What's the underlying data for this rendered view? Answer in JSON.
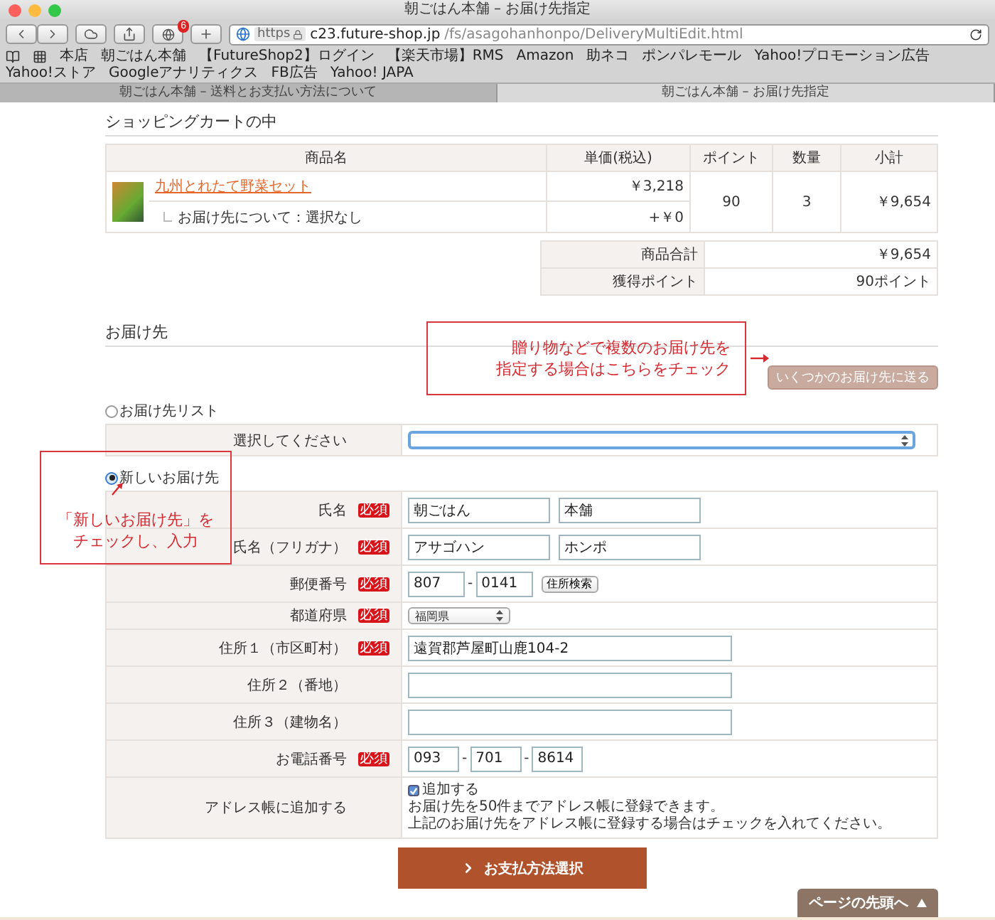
{
  "window": {
    "title": "朝ごはん本舗 – お届け先指定"
  },
  "toolbar": {
    "notification_count": "6",
    "url": {
      "scheme": "https",
      "host": "c23.future-shop.jp",
      "path": "/fs/asagohanhonpo/DeliveryMultiEdit.html"
    }
  },
  "bookmarks": [
    "本店",
    "朝ごはん本舗",
    "【FutureShop2】ログイン",
    "【楽天市場】RMS",
    "Amazon",
    "助ネコ",
    "ポンパレモール",
    "Yahoo!プロモーション広告",
    "Yahoo!ストア",
    "Googleアナリティクス",
    "FB広告",
    "Yahoo! JAPA"
  ],
  "tabs": [
    {
      "label": "朝ごはん本舗 – 送料とお支払い方法について",
      "selected": false
    },
    {
      "label": "朝ごはん本舗 – お届け先指定",
      "selected": true
    }
  ],
  "cart": {
    "heading": "ショッピングカートの中",
    "columns": [
      "商品名",
      "単価(税込)",
      "ポイント",
      "数量",
      "小計"
    ],
    "items": [
      {
        "name": "九州とれたて野菜セット",
        "option": "お届け先について：選択なし",
        "price": "￥3,218",
        "option_price": "+￥0",
        "points": "90",
        "quantity": "3",
        "subtotal": "￥9,654"
      }
    ],
    "summary": [
      {
        "label": "商品合計",
        "value": "￥9,654"
      },
      {
        "label": "獲得ポイント",
        "value": "90ポイント"
      }
    ]
  },
  "delivery": {
    "heading": "お届け先",
    "multi_button": "いくつかのお届け先に送る",
    "address_list": {
      "label": "お届け先リスト",
      "selected": false,
      "select_label": "選択してください"
    },
    "new_address": {
      "label": "新しいお届け先",
      "selected": true,
      "fields": [
        {
          "kind": "pair",
          "label": "氏名",
          "badge": "必須",
          "values": [
            "朝ごはん",
            "本舗"
          ]
        },
        {
          "kind": "pair",
          "label": "氏名（フリガナ）",
          "badge": "必須",
          "values": [
            "アサゴハン",
            "ホンポ"
          ]
        },
        {
          "kind": "zip",
          "label": "郵便番号",
          "badge": "必須",
          "values": [
            "807",
            "0141"
          ],
          "separator": "-",
          "button": "住所検索"
        },
        {
          "kind": "select",
          "label": "都道府県",
          "badge": "必須",
          "value": "福岡県"
        },
        {
          "kind": "text",
          "label": "住所１（市区町村）",
          "badge": "必須",
          "value": "遠賀郡芦屋町山鹿104-2"
        },
        {
          "kind": "text",
          "label": "住所２（番地）"
        },
        {
          "kind": "text",
          "label": "住所３（建物名）"
        },
        {
          "kind": "phone",
          "label": "お電話番号",
          "badge": "必須",
          "values": [
            "093",
            "701",
            "8614"
          ],
          "separator": "-"
        },
        {
          "kind": "checkbox",
          "label": "アドレス帳に追加する",
          "checkbox_label": "追加する",
          "checked": true,
          "notes": [
            "お届け先を50件までアドレス帳に登録できます。",
            "上記のお届け先をアドレス帳に登録する場合はチェックを入れてください。"
          ]
        }
      ]
    }
  },
  "submit": "お支払方法選択",
  "page_top": "ページの先頭へ",
  "annotations": [
    {
      "lines": [
        "贈り物などで複数のお届け先を",
        "指定する場合はこちらをチェック"
      ]
    },
    {
      "lines": [
        "「新しいお届け先」を",
        "チェックし、入力"
      ]
    }
  ]
}
